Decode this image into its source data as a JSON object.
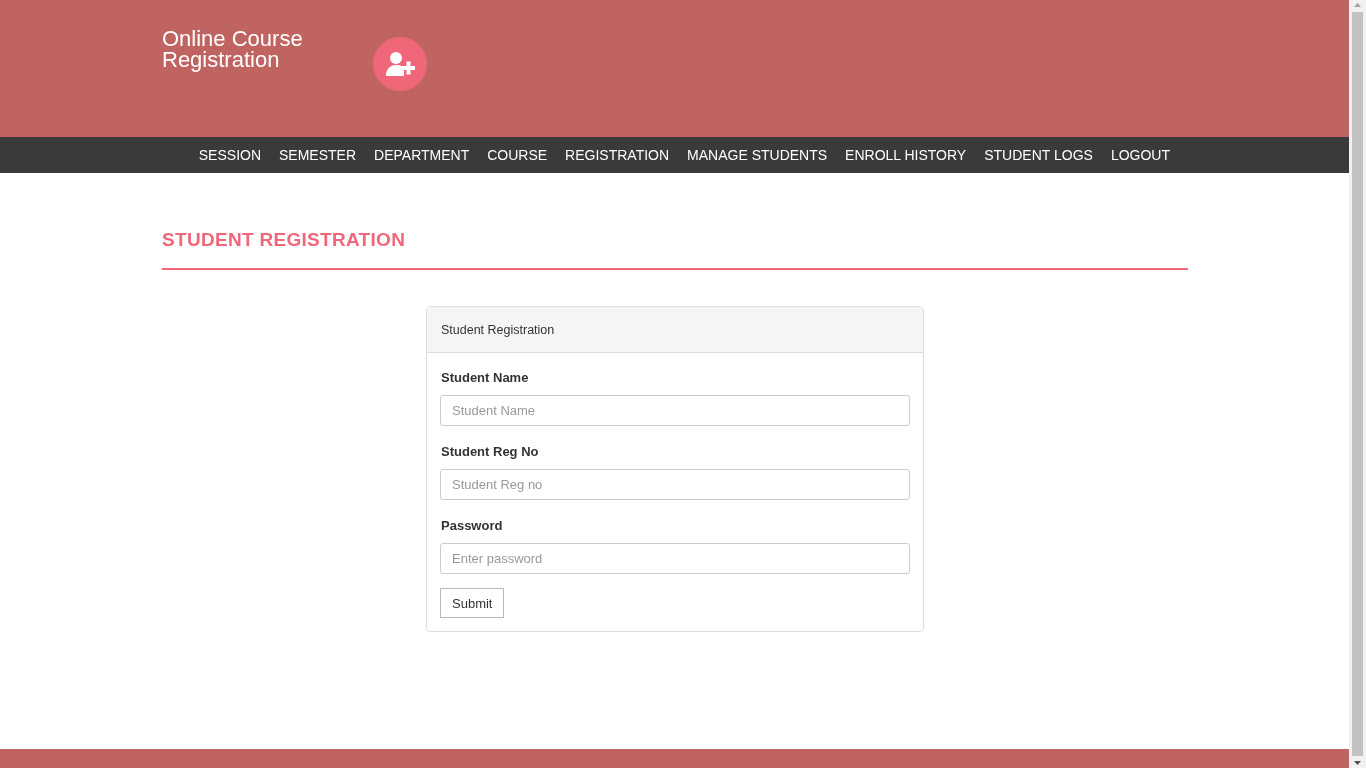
{
  "header": {
    "title_line_1": "Online Course",
    "title_line_2": "Registration"
  },
  "nav": {
    "items": [
      {
        "label": "SESSION"
      },
      {
        "label": "SEMESTER"
      },
      {
        "label": "DEPARTMENT"
      },
      {
        "label": "COURSE"
      },
      {
        "label": "REGISTRATION"
      },
      {
        "label": "MANAGE STUDENTS"
      },
      {
        "label": "ENROLL HISTORY"
      },
      {
        "label": "STUDENT LOGS"
      },
      {
        "label": "LOGOUT"
      }
    ]
  },
  "page": {
    "heading": "STUDENT REGISTRATION"
  },
  "panel": {
    "title": "Student Registration",
    "fields": [
      {
        "label": "Student Name",
        "placeholder": "Student Name"
      },
      {
        "label": "Student Reg No",
        "placeholder": "Student Reg no"
      },
      {
        "label": "Password",
        "placeholder": "Enter password"
      }
    ],
    "submit": "Submit"
  }
}
